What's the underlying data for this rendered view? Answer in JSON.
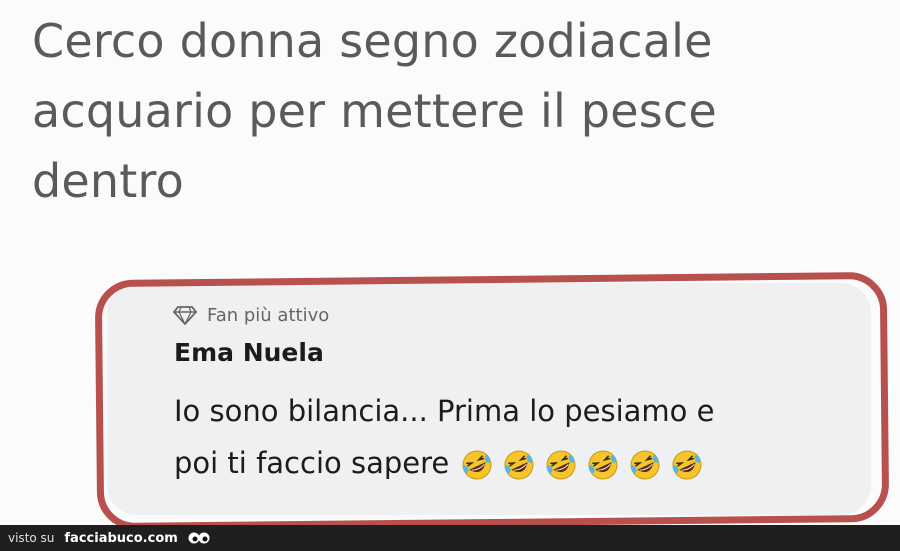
{
  "post": {
    "text_line1": "Cerco donna segno zodiacale",
    "text_line2": "acquario per mettere il pesce",
    "text_line3": "dentro"
  },
  "comment": {
    "badge_icon": "diamond-icon",
    "badge_label": "Fan più attivo",
    "author": "Ema Nuela",
    "text_line1": "Io sono bilancia... Prima lo pesiamo e",
    "text_line2": "poi ti faccio sapere",
    "emoji_name": "rolling-on-floor-laughing-icon",
    "emoji_count": 6
  },
  "footer": {
    "prefix": "visto su",
    "brand": "facciabuco.com",
    "brand_icon": "eyes-icon"
  },
  "colors": {
    "highlight_ring": "#b8504d",
    "bubble_bg": "#eef0f2",
    "post_text": "#5a5a5a",
    "emoji_fill": "#f5c52b"
  }
}
